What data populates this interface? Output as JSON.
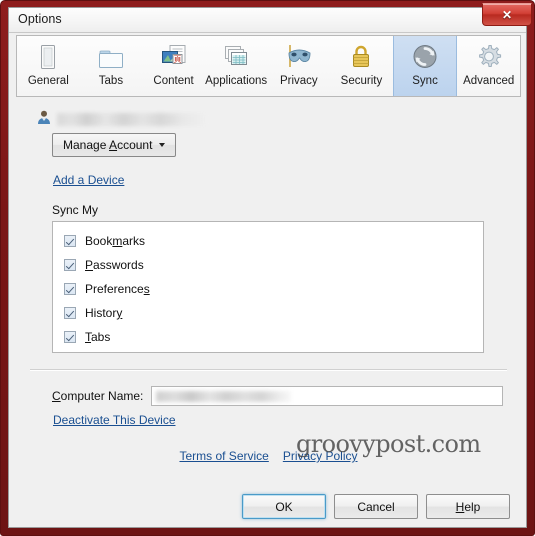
{
  "window": {
    "title": "Options",
    "close_label": "✕",
    "frame_color": "#7a1717"
  },
  "toolbar": {
    "items": [
      {
        "label": "General",
        "icon": "general-icon",
        "selected": false
      },
      {
        "label": "Tabs",
        "icon": "tabs-icon",
        "selected": false
      },
      {
        "label": "Content",
        "icon": "content-icon",
        "selected": false
      },
      {
        "label": "Applications",
        "icon": "applications-icon",
        "selected": false
      },
      {
        "label": "Privacy",
        "icon": "privacy-mask-icon",
        "selected": false
      },
      {
        "label": "Security",
        "icon": "padlock-icon",
        "selected": false
      },
      {
        "label": "Sync",
        "icon": "sync-icon",
        "selected": true
      },
      {
        "label": "Advanced",
        "icon": "gear-icon",
        "selected": false
      }
    ],
    "selected_color": "#bcd3ee"
  },
  "account": {
    "avatar_icon": "user-avatar-icon",
    "name_redacted": "",
    "manage_button": {
      "pre": "Manage ",
      "accel": "A",
      "post": "ccount"
    },
    "add_device_link": "Add a Device"
  },
  "sync": {
    "group_label": "Sync My",
    "items": [
      {
        "pre": "Book",
        "accel": "m",
        "post": "arks",
        "checked": true
      },
      {
        "pre": "",
        "accel": "P",
        "post": "asswords",
        "checked": true
      },
      {
        "pre": "Preference",
        "accel": "s",
        "post": "",
        "checked": true
      },
      {
        "pre": "Histor",
        "accel": "y",
        "post": "",
        "checked": true
      },
      {
        "pre": "",
        "accel": "T",
        "post": "abs",
        "checked": true
      }
    ]
  },
  "device": {
    "computer_name_label": {
      "pre": "",
      "accel": "C",
      "post": "omputer Name:"
    },
    "computer_name_value": "",
    "computer_name_placeholder": "",
    "deactivate_link": "Deactivate This Device"
  },
  "footer": {
    "terms_link": "Terms of Service",
    "privacy_link": "Privacy Policy",
    "watermark": "groovypost.com"
  },
  "dialog_buttons": {
    "ok": {
      "pre": "OK",
      "accel": "",
      "post": ""
    },
    "cancel": {
      "pre": "Cancel",
      "accel": "",
      "post": ""
    },
    "help": {
      "pre": "",
      "accel": "H",
      "post": "elp"
    }
  },
  "link_color": "#1a4f91"
}
